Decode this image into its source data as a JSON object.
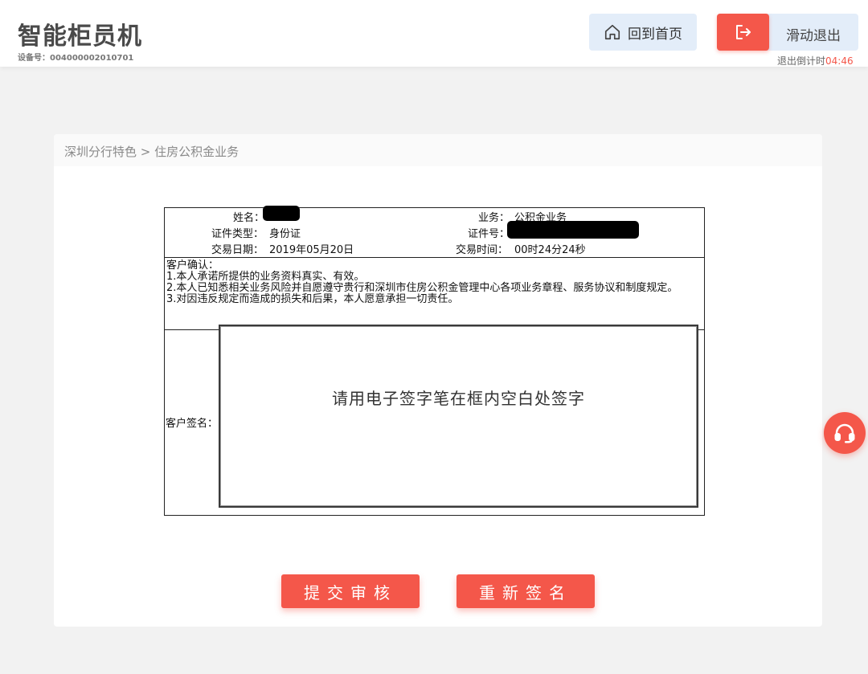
{
  "header": {
    "title": "智能柜员机",
    "device_no": "设备号：004000002010701",
    "home_label": "回到首页",
    "exit_label": "滑动退出",
    "countdown_label": "退出倒计时",
    "countdown_time": "04:46"
  },
  "breadcrumb": "深圳分行特色 > 住房公积金业务",
  "form": {
    "name_label": "姓名：",
    "business_label": "业务：",
    "business_value": "公积金业务",
    "id_type_label": "证件类型：",
    "id_type_value": "身份证",
    "id_no_label": "证件号：",
    "trade_date_label": "交易日期：",
    "trade_date_value": "2019年05月20日",
    "trade_time_label": "交易时间：",
    "trade_time_value": "00时24分24秒",
    "confirm_title": "客户确认：",
    "confirm_items": [
      "1.本人承诺所提供的业务资料真实、有效。",
      "2.本人已知悉相关业务风险并自愿遵守贵行和深圳市住房公积金管理中心各项业务章程、服务协议和制度规定。",
      "3.对因违反规定而造成的损失和后果，本人愿意承担一切责任。"
    ],
    "signature_label": "客户签名：",
    "signature_hint": "请用电子签字笔在框内空白处签字"
  },
  "actions": {
    "submit_label": "提交审核",
    "resign_label": "重新签名"
  },
  "icons": {
    "home": "home-icon",
    "exit": "exit-icon",
    "support": "headset-icon"
  },
  "colors": {
    "accent": "#f4574a",
    "button_bg": "#e3edf9"
  }
}
